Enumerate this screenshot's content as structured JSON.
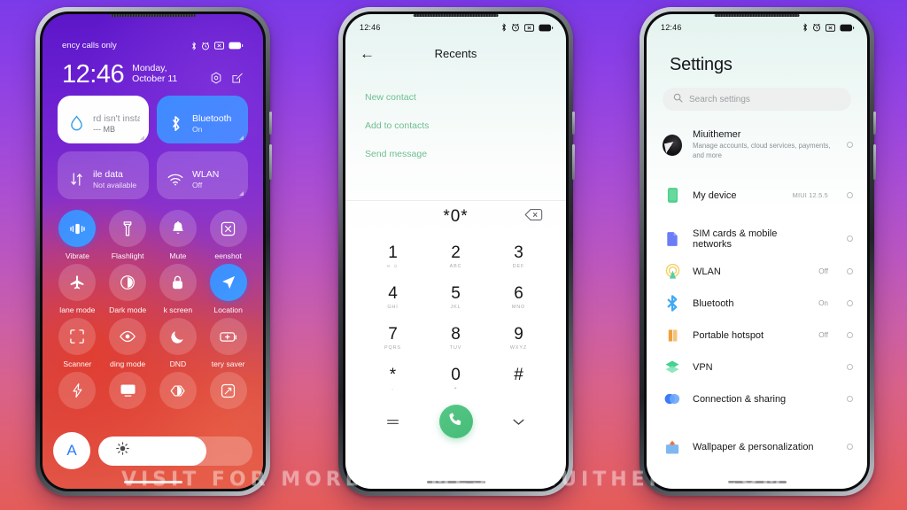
{
  "watermark": "VISIT FOR MORE THEMES - MIUITHEMER.COM",
  "status_bar": {
    "time": "12:46",
    "icons": [
      "bluetooth-icon",
      "alarm-icon",
      "mute-icon",
      "battery-icon"
    ]
  },
  "phone1": {
    "name": "control-center",
    "carrier": "ency calls only",
    "clock": "12:46",
    "date": "Monday, October 11",
    "header_icons": [
      "settings-gear-icon",
      "edit-icon"
    ],
    "big_tiles": [
      {
        "title": "rd isn't install",
        "subtitle": "--- MB",
        "icon": "water-drop-icon",
        "style": "light"
      },
      {
        "title": "Bluetooth",
        "subtitle": "On",
        "icon": "bluetooth-icon",
        "style": "blue"
      },
      {
        "title": "ile data",
        "subtitle": "Not available",
        "icon": "data-transfer-icon",
        "style": "glass"
      },
      {
        "title": "WLAN",
        "subtitle": "Off",
        "icon": "wifi-icon",
        "style": "glass"
      }
    ],
    "tiles": [
      {
        "label": "Vibrate",
        "icon": "vibrate-icon",
        "on": true
      },
      {
        "label": "Flashlight",
        "icon": "flashlight-icon",
        "on": false
      },
      {
        "label": "Mute",
        "icon": "bell-icon",
        "on": false
      },
      {
        "label": "eenshot",
        "icon": "screenshot-icon",
        "on": false
      },
      {
        "label": "lane mode",
        "icon": "airplane-icon",
        "on": false
      },
      {
        "label": "Dark mode",
        "icon": "contrast-icon",
        "on": false
      },
      {
        "label": "k screen",
        "icon": "lock-icon",
        "on": false
      },
      {
        "label": "Location",
        "icon": "location-arrow-icon",
        "on": true
      },
      {
        "label": "Scanner",
        "icon": "scanner-icon",
        "on": false
      },
      {
        "label": "ding mode",
        "icon": "eye-icon",
        "on": false
      },
      {
        "label": "DND",
        "icon": "moon-icon",
        "on": false
      },
      {
        "label": "tery saver",
        "icon": "battery-plus-icon",
        "on": false
      },
      {
        "label": "",
        "icon": "bolt-icon",
        "on": false
      },
      {
        "label": "",
        "icon": "cast-icon",
        "on": false
      },
      {
        "label": "",
        "icon": "sync-icon",
        "on": false
      },
      {
        "label": "",
        "icon": "rotate-icon",
        "on": false
      }
    ],
    "brightness": {
      "auto_label": "A",
      "icon": "sun-icon",
      "level": 70
    }
  },
  "phone2": {
    "name": "dialer",
    "title": "Recents",
    "back_icon": "arrow-left-icon",
    "actions": [
      "New contact",
      "Add to contacts",
      "Send message"
    ],
    "entered_number": "*0*",
    "delete_icon": "backspace-icon",
    "keys": [
      {
        "digit": "1",
        "sub": "∞ ☺"
      },
      {
        "digit": "2",
        "sub": "ABC"
      },
      {
        "digit": "3",
        "sub": "DEF"
      },
      {
        "digit": "4",
        "sub": "GHI"
      },
      {
        "digit": "5",
        "sub": "JKL"
      },
      {
        "digit": "6",
        "sub": "MNO"
      },
      {
        "digit": "7",
        "sub": "PQRS"
      },
      {
        "digit": "8",
        "sub": "TUV"
      },
      {
        "digit": "9",
        "sub": "WXYZ"
      },
      {
        "digit": "*",
        "sub": ","
      },
      {
        "digit": "0",
        "sub": "+"
      },
      {
        "digit": "#",
        "sub": ""
      }
    ],
    "bottom": {
      "left_icon": "keypad-toggle-icon",
      "call_icon": "call-icon",
      "right_icon": "chevron-down-icon"
    }
  },
  "phone3": {
    "name": "settings",
    "title": "Settings",
    "search_placeholder": "Search settings",
    "search_icon": "search-icon",
    "account": {
      "name": "Miuithemer",
      "subtitle": "Manage accounts, cloud services, payments, and more",
      "avatar": "avatar-icon"
    },
    "rows": [
      {
        "label": "My device",
        "value": "MIUI 12.5.5",
        "icon": "device-icon",
        "color": "#4fd08a"
      },
      {
        "gap": true
      },
      {
        "label": "SIM cards & mobile networks",
        "value": "",
        "icon": "sim-card-icon",
        "color": "#6b7cf6"
      },
      {
        "label": "WLAN",
        "value": "Off",
        "icon": "wifi-icon",
        "color": "#f0c040"
      },
      {
        "label": "Bluetooth",
        "value": "On",
        "icon": "bluetooth-icon",
        "color": "#3fa9f5"
      },
      {
        "label": "Portable hotspot",
        "value": "Off",
        "icon": "hotspot-icon",
        "color": "#f0a03a"
      },
      {
        "label": "VPN",
        "value": "",
        "icon": "vpn-icon",
        "color": "#45d18f"
      },
      {
        "label": "Connection & sharing",
        "value": "",
        "icon": "sharing-icon",
        "color": "#3a7df5"
      },
      {
        "gap_lg": true
      },
      {
        "label": "Wallpaper & personalization",
        "value": "",
        "icon": "wallpaper-icon",
        "color": "#f2a03d"
      }
    ],
    "chevron_icon": "chevron-right-icon"
  }
}
